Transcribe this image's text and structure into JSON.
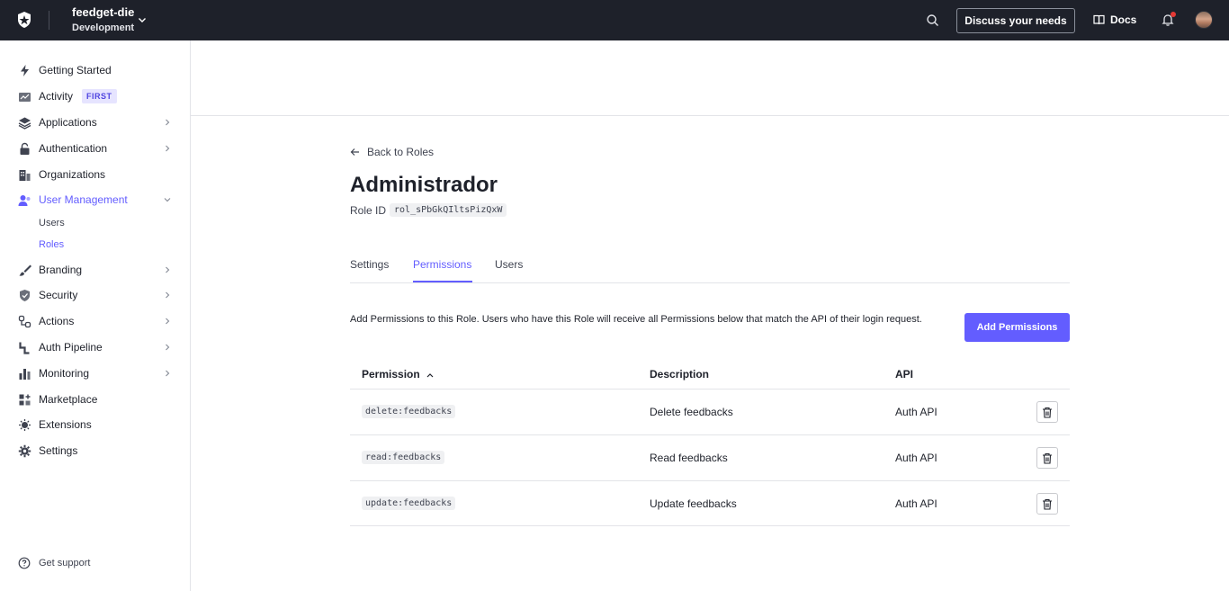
{
  "topbar": {
    "tenant_name": "feedget-die",
    "tenant_env": "Development",
    "discuss_label": "Discuss your needs",
    "docs_label": "Docs",
    "notification_dot_color": "#e53935"
  },
  "sidebar": {
    "items": [
      {
        "label": "Getting Started",
        "icon": "bolt-icon"
      },
      {
        "label": "Activity",
        "icon": "chart-icon",
        "badge": "FIRST"
      },
      {
        "label": "Applications",
        "icon": "layers-icon"
      },
      {
        "label": "Authentication",
        "icon": "lock-icon"
      },
      {
        "label": "Organizations",
        "icon": "building-icon"
      },
      {
        "label": "User Management",
        "icon": "users-icon"
      },
      {
        "label": "Branding",
        "icon": "brush-icon"
      },
      {
        "label": "Security",
        "icon": "shield-icon"
      },
      {
        "label": "Actions",
        "icon": "actions-icon"
      },
      {
        "label": "Auth Pipeline",
        "icon": "pipeline-icon"
      },
      {
        "label": "Monitoring",
        "icon": "bars-icon"
      },
      {
        "label": "Marketplace",
        "icon": "grid-plus-icon"
      },
      {
        "label": "Extensions",
        "icon": "puzzle-icon"
      },
      {
        "label": "Settings",
        "icon": "gear-icon"
      }
    ],
    "user_management_sub": [
      "Users",
      "Roles"
    ],
    "support_label": "Get support"
  },
  "main": {
    "back_label": "Back to Roles",
    "title": "Administrador",
    "role_id_label": "Role ID",
    "role_id": "rol_sPbGkQIltsPizQxW",
    "tabs": [
      "Settings",
      "Permissions",
      "Users"
    ],
    "description": "Add Permissions to this Role. Users who have this Role will receive all Permissions below that match the API of their login request.",
    "add_button": "Add Permissions",
    "table": {
      "headers": [
        "Permission",
        "Description",
        "API"
      ],
      "rows": [
        {
          "permission": "delete:feedbacks",
          "description": "Delete feedbacks",
          "api": "Auth API"
        },
        {
          "permission": "read:feedbacks",
          "description": "Read feedbacks",
          "api": "Auth API"
        },
        {
          "permission": "update:feedbacks",
          "description": "Update feedbacks",
          "api": "Auth API"
        }
      ]
    }
  },
  "colors": {
    "accent": "#635dff",
    "topbar": "#1e212a"
  }
}
